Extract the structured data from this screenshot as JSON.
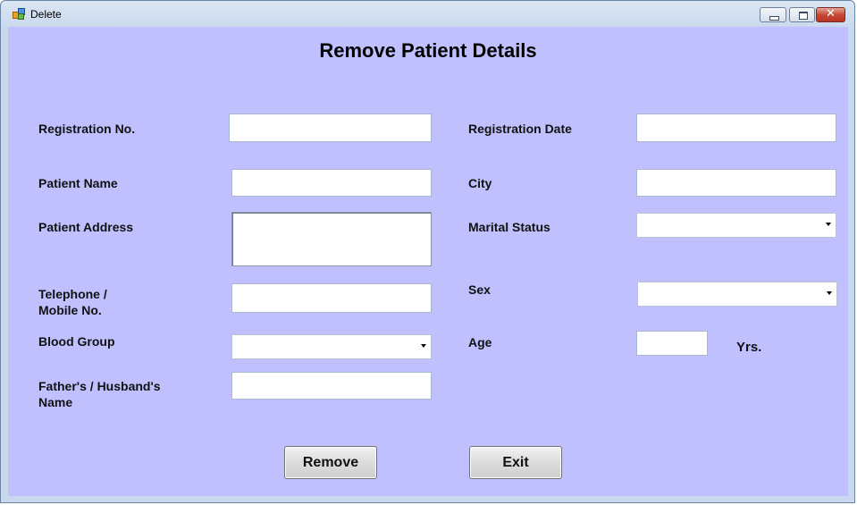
{
  "window": {
    "title": "Delete",
    "close_glyph": "✕",
    "icons": {
      "app": "app-icon",
      "minimize": "minimize-icon",
      "maximize": "maximize-icon",
      "close": "close-icon"
    }
  },
  "form": {
    "heading": "Remove Patient Details",
    "background": "#c0c0ff",
    "left": {
      "registration_no": {
        "label": "Registration No.",
        "value": ""
      },
      "patient_name": {
        "label": "Patient Name",
        "value": ""
      },
      "patient_address": {
        "label": "Patient Address",
        "value": ""
      },
      "telephone": {
        "label_line1": "Telephone /",
        "label_line2": "Mobile No.",
        "value": ""
      },
      "blood_group": {
        "label": "Blood Group",
        "value": ""
      },
      "father_husband": {
        "label_line1": "Father's / Husband's",
        "label_line2": "Name",
        "value": ""
      }
    },
    "right": {
      "registration_date": {
        "label": "Registration Date",
        "value": ""
      },
      "city": {
        "label": "City",
        "value": ""
      },
      "marital_status": {
        "label": "Marital Status",
        "value": ""
      },
      "sex": {
        "label": "Sex",
        "value": ""
      },
      "age": {
        "label": "Age",
        "value": "",
        "unit": "Yrs."
      }
    },
    "buttons": {
      "remove": "Remove",
      "exit": "Exit"
    }
  }
}
